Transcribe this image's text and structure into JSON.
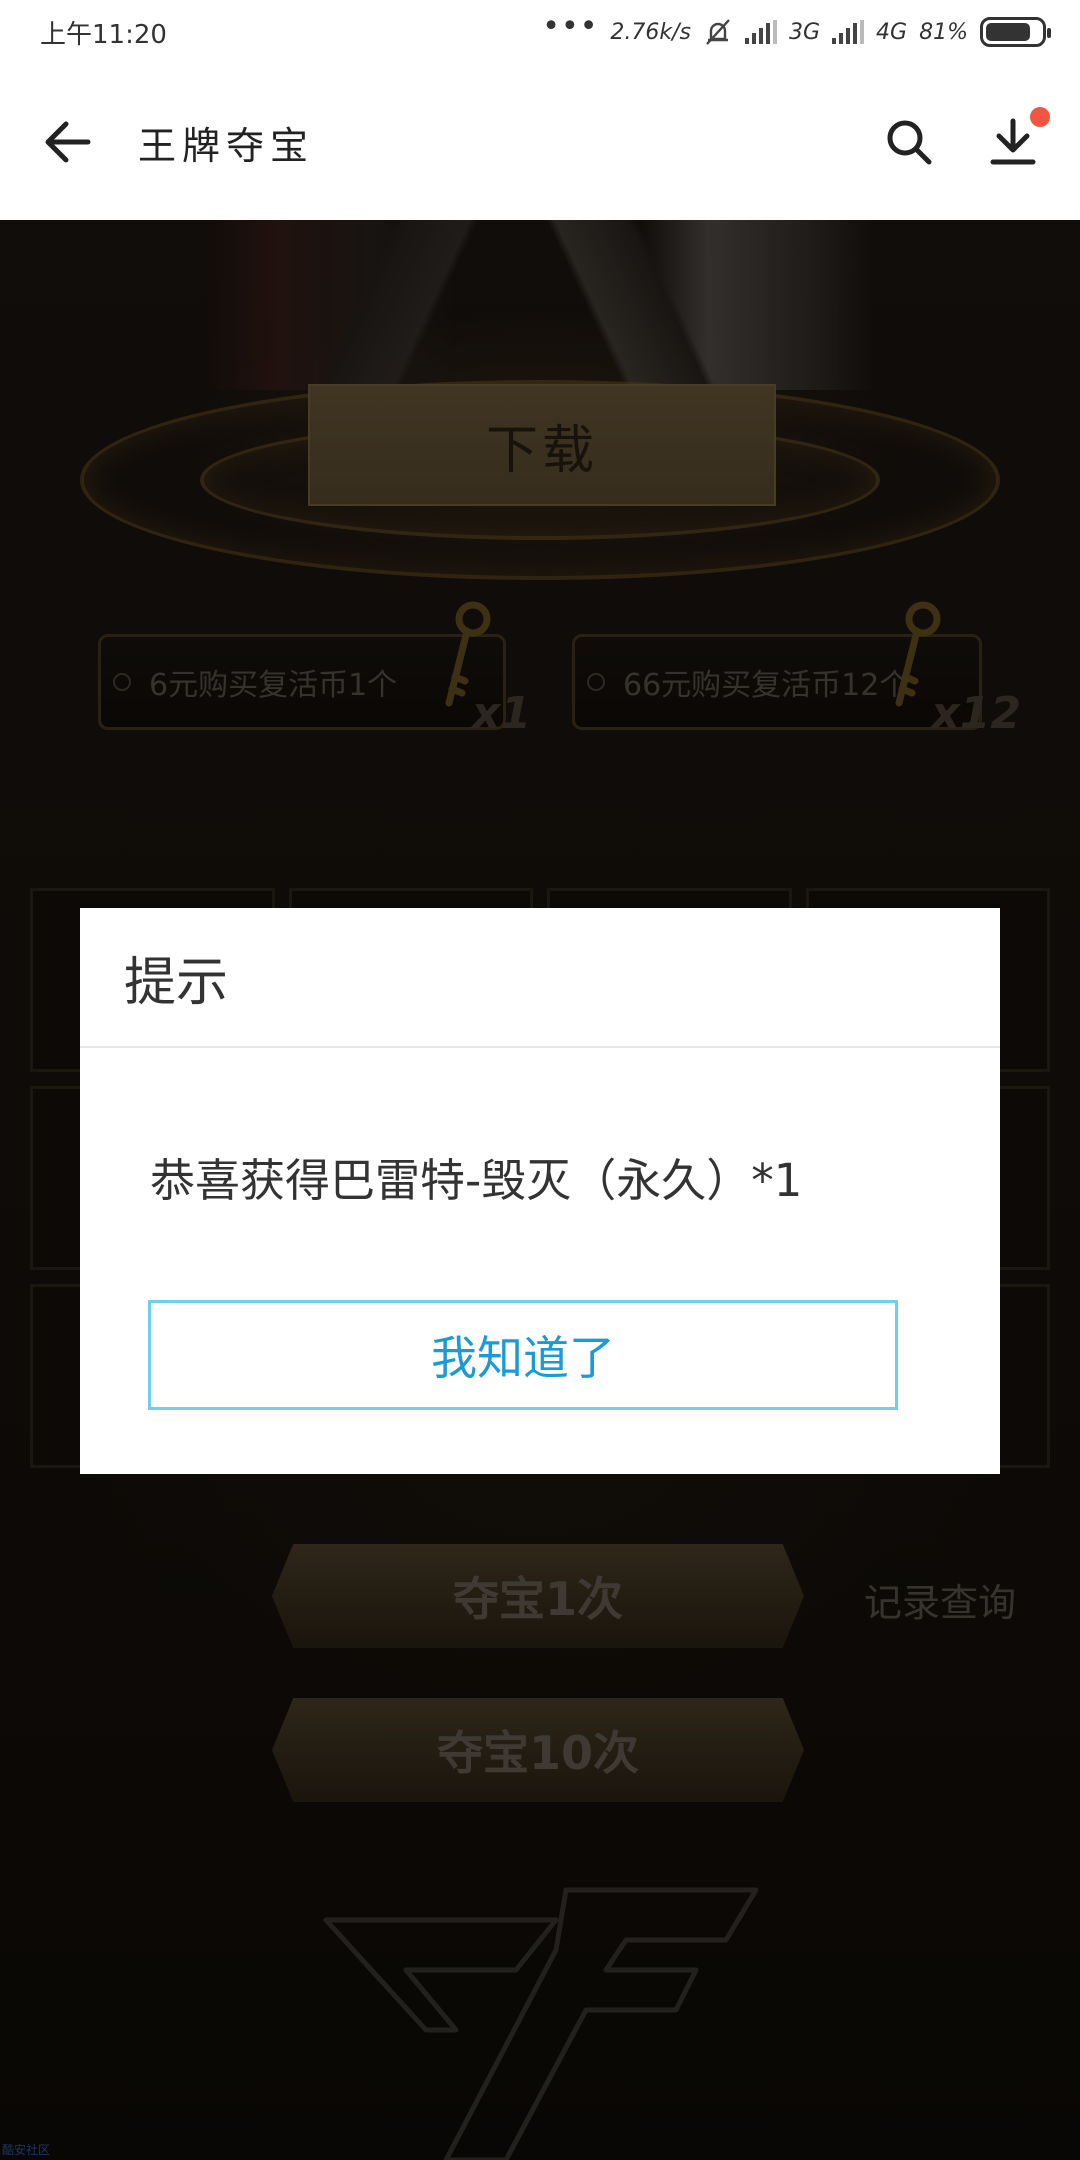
{
  "status_bar": {
    "time": "上午11:20",
    "dots": "•••",
    "net_speed": "2.76k/s",
    "net_3g": "3G",
    "net_4g": "4G",
    "battery": "81%"
  },
  "app_bar": {
    "title": "王牌夺宝",
    "has_notification": true,
    "colors": {
      "notification": "#f25643"
    }
  },
  "game": {
    "download_label": "下载",
    "purchase_options": [
      {
        "label": "6元购买复活币1个",
        "qty": "x1"
      },
      {
        "label": "66元购买复活币12个",
        "qty": "x12"
      }
    ],
    "draw_once_label": "夺宝1次",
    "draw_ten_label": "夺宝10次",
    "record_label": "记录查询",
    "logo_icon": "cf-logo"
  },
  "dialog": {
    "title": "提示",
    "message": "恭喜获得巴雷特-毁灭（永久）*1",
    "confirm_label": "我知道了",
    "colors": {
      "confirm_text": "#1c9ad6",
      "confirm_border": "#6fd0ea"
    }
  },
  "watermark": "酷安社区"
}
